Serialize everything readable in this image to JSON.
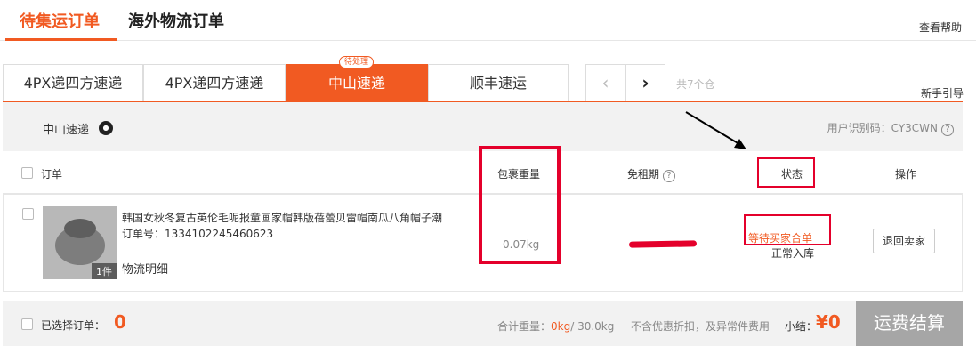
{
  "top_tabs": [
    {
      "label": "待集运订单",
      "active": true
    },
    {
      "label": "海外物流订单",
      "active": false
    }
  ],
  "help_link": "查看帮助",
  "carrier_tabs": [
    {
      "label": "4PX递四方速递",
      "active": false
    },
    {
      "label": "4PX递四方速递",
      "active": false
    },
    {
      "label": "中山速递",
      "active": true
    },
    {
      "label": "顺丰速运",
      "active": false
    }
  ],
  "pending_badge": "待处理",
  "nav": {
    "prev": "‹",
    "next": "›"
  },
  "warehouse_count": "共7个仓",
  "guide_link": "新手引导",
  "carrier_info": {
    "name": "中山速递",
    "user_code_label": "用户识别码：CY3CWN",
    "help_icon": "?"
  },
  "table_header": {
    "order": "订单",
    "weight": "包裹重量",
    "free_period": "免租期",
    "free_period_help": "?",
    "status": "状态",
    "operation": "操作"
  },
  "order": {
    "thumbnail_count": "1件",
    "title": "韩国女秋冬复古英伦毛呢报童画家帽韩版蓓蕾贝雷帽南瓜八角帽子潮",
    "order_no": "订单号：1334102245460623",
    "logistics_detail": "物流明细",
    "weight": "0.07kg",
    "status_main": "等待买家合单",
    "status_sub": "正常入库",
    "action": "退回卖家"
  },
  "footer": {
    "selected_label": "已选择订单：",
    "selected_count": "0",
    "weight_label": "合计重量：",
    "weight_selected": "0kg",
    "weight_total": "/ 30.0kg",
    "note": "不含优惠折扣，及异常件费用",
    "subtotal_label": "小结：",
    "subtotal": "¥0",
    "checkout": "运费结算"
  },
  "colors": {
    "accent": "#f15a22",
    "annotation": "#e4002b",
    "checkout_disabled": "#a6a6a6"
  }
}
